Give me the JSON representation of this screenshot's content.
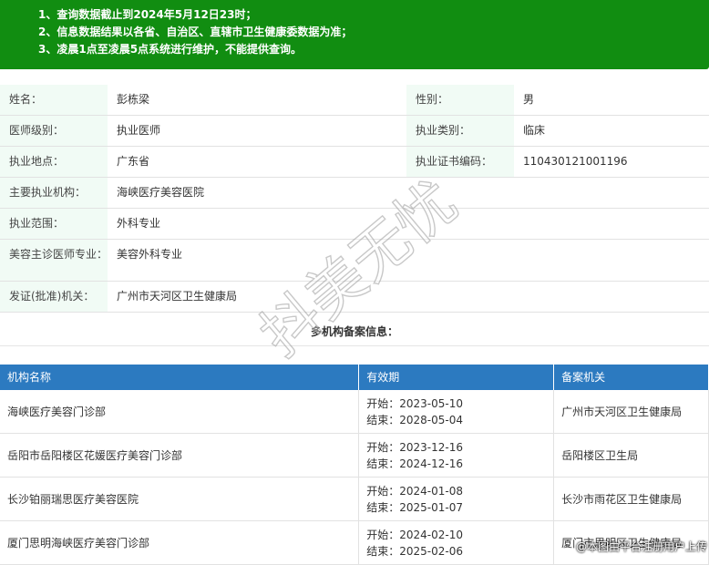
{
  "notice": [
    "1、查询数据截止到2024年5月12日23时；",
    "2、信息数据结果以各省、自治区、直辖市卫生健康委数据为准；",
    "3、凌晨1点至凌晨5点系统进行维护，不能提供查询。"
  ],
  "info": {
    "name_label": "姓名：",
    "name": "彭栋梁",
    "gender_label": "性别：",
    "gender": "男",
    "level_label": "医师级别：",
    "level": "执业医师",
    "category_label": "执业类别：",
    "category": "临床",
    "location_label": "执业地点：",
    "location": "广东省",
    "cert_label": "执业证书编码：",
    "cert": "110430121001196",
    "org_label": "主要执业机构：",
    "org": "海峡医疗美容医院",
    "scope_label": "执业范围：",
    "scope": "外科专业",
    "cosmetic_label": "美容主诊医师专业：",
    "cosmetic": "美容外科专业",
    "issuer_label": "发证(批准)机关：",
    "issuer": "广州市天河区卫生健康局"
  },
  "multi_title": "多机构备案信息：",
  "org_table": {
    "headers": [
      "机构名称",
      "有效期",
      "备案机关"
    ],
    "rows": [
      {
        "name": "海峡医疗美容门诊部",
        "start": "开始：2023-05-10",
        "end": "结束：2028-05-04",
        "authority": "广州市天河区卫生健康局"
      },
      {
        "name": "岳阳市岳阳楼区花媛医疗美容门诊部",
        "start": "开始：2023-12-16",
        "end": "结束：2024-12-16",
        "authority": "岳阳楼区卫生局"
      },
      {
        "name": "长沙铂丽瑞思医疗美容医院",
        "start": "开始：2024-01-08",
        "end": "结束：2025-01-07",
        "authority": "长沙市雨花区卫生健康局"
      },
      {
        "name": "厦门思明海峡医疗美容门诊部",
        "start": "开始：2024-02-10",
        "end": "结束：2025-02-06",
        "authority": "厦门市思明区卫生健康局"
      }
    ]
  },
  "watermark": "抖美无忧",
  "credit": "@本图由平台注册用户上传"
}
